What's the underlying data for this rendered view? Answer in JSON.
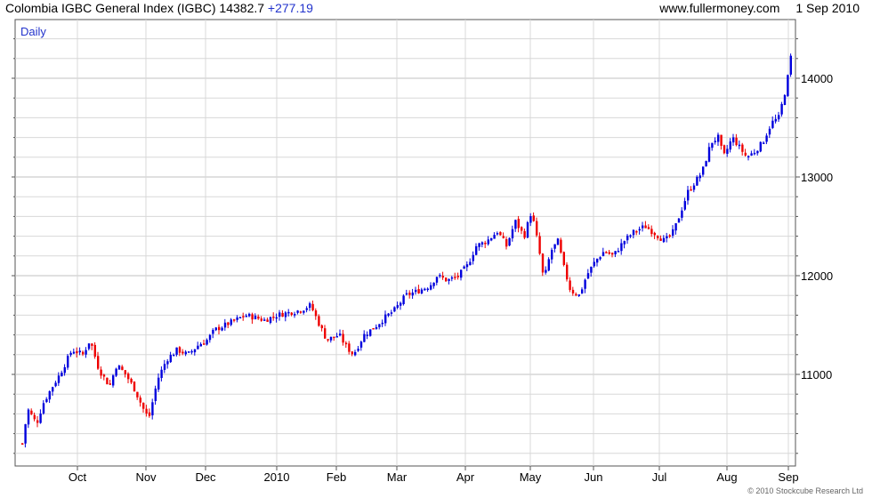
{
  "header": {
    "title": "Colombia IGBC General Index (IGBC)",
    "last": "14382.7",
    "change": "+277.19",
    "source": "www.fullermoney.com",
    "date": "1 Sep 2010"
  },
  "footer": {
    "copyright": "© 2010 Stockcube Research Ltd"
  },
  "chart_data": {
    "type": "candlestick",
    "title": "Colombia IGBC General Index (IGBC)",
    "period_label": "Daily",
    "x_axis": {
      "labels": [
        "Oct",
        "Nov",
        "Dec",
        "2010",
        "Feb",
        "Mar",
        "Apr",
        "May",
        "Jun",
        "Jul",
        "Aug",
        "Sep"
      ]
    },
    "y_axis": {
      "labels": [
        "11000",
        "12000",
        "13000",
        "14000"
      ],
      "range": [
        10000,
        14400
      ],
      "position": "right"
    },
    "grid": true,
    "colors": {
      "up": "#0000dd",
      "down": "#ee0000",
      "grid": "#d8d8d8",
      "major_grid": "#c0c0c0"
    },
    "close_series": [
      {
        "month": "Sep 2009",
        "close": 10600
      },
      {
        "month": "Oct 2009",
        "close": 10900
      },
      {
        "month": "Nov 2009",
        "close": 11450
      },
      {
        "month": "Dec 2009",
        "close": 11550
      },
      {
        "month": "Jan 2010",
        "close": 11300
      },
      {
        "month": "Feb 2010",
        "close": 11800
      },
      {
        "month": "Mar 2010",
        "close": 11980
      },
      {
        "month": "Apr 2010",
        "close": 12500
      },
      {
        "month": "May 2010",
        "close": 11950
      },
      {
        "month": "Jun 2010",
        "close": 12450
      },
      {
        "month": "Jul 2010",
        "close": 13450
      },
      {
        "month": "Aug 2010",
        "close": 14100
      },
      {
        "month": "1 Sep 2010",
        "close": 14382.7
      }
    ]
  }
}
